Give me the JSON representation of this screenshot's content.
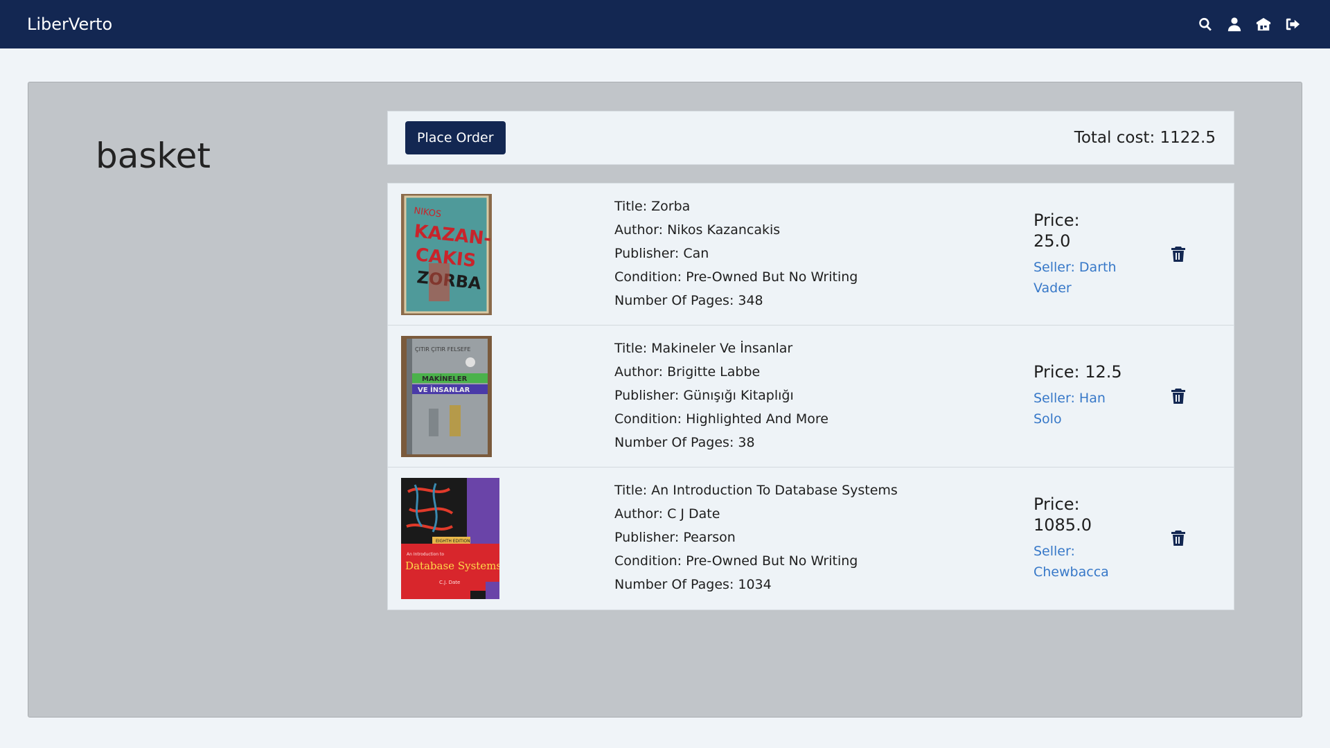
{
  "nav": {
    "brand": "LiberVerto",
    "icons": [
      "search-icon",
      "user-icon",
      "store-icon",
      "logout-icon"
    ]
  },
  "page": {
    "title": "basket"
  },
  "order": {
    "place_order_label": "Place Order",
    "total_cost": "Total cost: 1122.5"
  },
  "items": [
    {
      "title": "Title: Zorba",
      "author": "Author: Nikos Kazancakis",
      "publisher": "Publisher: Can",
      "condition": "Condition: Pre-Owned But No Writing",
      "pages": "Number Of Pages: 348",
      "price_lines": [
        "Price:",
        "25.0"
      ],
      "seller_lines": [
        "Seller: Darth",
        "Vader"
      ],
      "cover_text": [
        "NIKOS",
        "KAZAN-",
        "CAKIS",
        "ZORBA"
      ]
    },
    {
      "title": "Title: Makineler Ve İnsanlar",
      "author": "Author: Brigitte Labbe",
      "publisher": "Publisher: Günışığı Kitaplığı",
      "condition": "Condition: Highlighted And More",
      "pages": "Number Of Pages: 38",
      "price_lines": [
        "Price: 12.5"
      ],
      "seller_lines": [
        "Seller: Han",
        "Solo"
      ],
      "cover_text": [
        "ÇITIR ÇITIR FELSEFE",
        "MAKİNELER",
        "VE İNSANLAR"
      ]
    },
    {
      "title": "Title: An Introduction To Database Systems",
      "author": "Author: C J Date",
      "publisher": "Publisher: Pearson",
      "condition": "Condition: Pre-Owned But No Writing",
      "pages": "Number Of Pages: 1034",
      "price_lines": [
        "Price:",
        "1085.0"
      ],
      "seller_lines": [
        "Seller:",
        "Chewbacca"
      ],
      "cover_text": [
        "EIGHTH EDITION",
        "An Introduction to",
        "Database Systems",
        "C.J. Date"
      ]
    }
  ],
  "colors": {
    "navbar": "#132752",
    "panel": "#c1c5c9",
    "link": "#3778c8"
  }
}
